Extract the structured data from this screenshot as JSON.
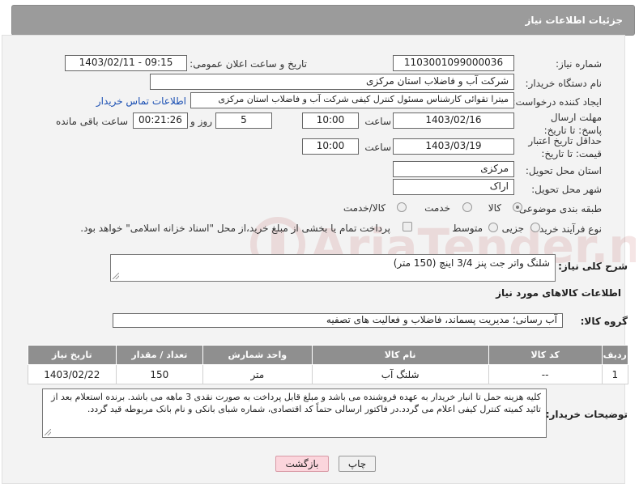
{
  "header": {
    "title": "جزئیات اطلاعات نیاز"
  },
  "fields": {
    "need_number_label": "شماره نیاز:",
    "need_number": "1103001099000036",
    "announce_label": "تاریخ و ساعت اعلان عمومی:",
    "announce_value": "1403/02/11 - 09:15",
    "buyer_org_label": "نام دستگاه خریدار:",
    "buyer_org": "شرکت آب و فاضلاب استان مرکزی",
    "creator_label": "ایجاد کننده درخواست:",
    "creator": "میترا تقوائی کارشناس مسئول کنترل کیفی شرکت آب و فاضلاب استان مرکزی",
    "contact_link": "اطلاعات تماس خریدار",
    "deadline_label": "مهلت ارسال پاسخ: تا تاریخ:",
    "deadline_date": "1403/02/16",
    "time_label": "ساعت",
    "deadline_time": "10:00",
    "days_value": "5",
    "days_label": "روز و",
    "remaining_time": "00:21:26",
    "remaining_label": "ساعت باقی مانده",
    "validity_label": "حداقل تاریخ اعتبار قیمت: تا تاریخ:",
    "validity_date": "1403/03/19",
    "validity_time": "10:00",
    "province_label": "استان محل تحویل:",
    "province": "مرکزی",
    "city_label": "شهر محل تحویل:",
    "city": "اراک",
    "category_label": "طبقه بندی موضوعی:",
    "category_options": [
      "کالا",
      "خدمت",
      "کالا/خدمت"
    ],
    "process_label": "نوع فرآیند خرید :",
    "process_options": [
      "جزیی",
      "متوسط"
    ],
    "process_note": "پرداخت تمام یا بخشی از مبلغ خرید،از محل \"اسناد خزانه اسلامی\" خواهد بود."
  },
  "description": {
    "label": "شرح کلی نیاز:",
    "value": "شلنگ واتر جت پنز 3/4 اینچ (150 متر)"
  },
  "goods_section": {
    "title": "اطلاعات کالاهای مورد نیاز",
    "group_label": "گروه کالا:",
    "group_value": "آب رسانی؛ مدیریت پسماند، فاضلاب و فعالیت های تصفیه"
  },
  "table": {
    "headers": [
      "ردیف",
      "کد کالا",
      "نام کالا",
      "واحد شمارش",
      "تعداد / مقدار",
      "تاریخ نیاز"
    ],
    "rows": [
      [
        "1",
        "--",
        "شلنگ آب",
        "متر",
        "150",
        "1403/02/22"
      ]
    ]
  },
  "buyer_notes": {
    "label": "توضیحات خریدار:",
    "value": "کلیه هزینه حمل تا انبار خریدار به عهده فروشنده می باشد و مبلغ قابل پرداخت به صورت نقدی 3 ماهه می باشد. برنده استعلام بعد از تائید کمیته کنترل کیفی اعلام می گردد.در فاکتور ارسالی حتماً کد اقتصادی، شماره شبای بانکی و نام بانک مربوطه قید گردد."
  },
  "buttons": {
    "print": "چاپ",
    "back": "بازگشت"
  },
  "watermark": {
    "text": "AriaTender.neT"
  }
}
